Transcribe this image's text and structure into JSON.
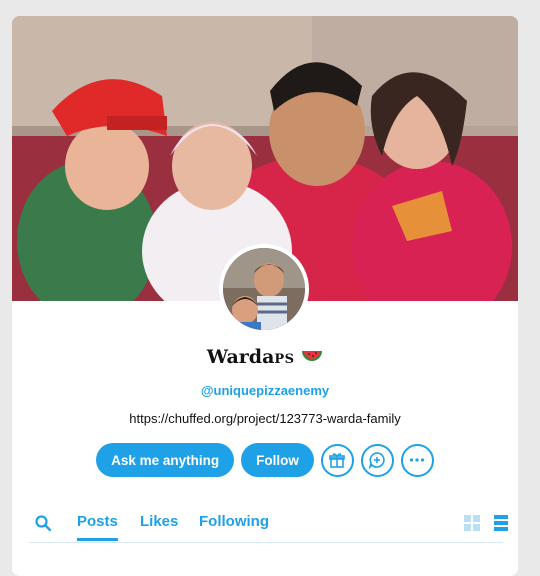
{
  "profile": {
    "name": "Warda",
    "name_suffix": "PS",
    "handle": "@uniquepizzaenemy",
    "url": "https://chuffed.org/project/123773-warda-family"
  },
  "actions": {
    "ask_label": "Ask me anything",
    "follow_label": "Follow",
    "icons": [
      "gift-icon",
      "message-plus-icon",
      "more-icon"
    ]
  },
  "tabs": {
    "items": [
      "Posts",
      "Likes",
      "Following"
    ],
    "active": "Posts"
  },
  "colors": {
    "accent": "#1ea1e6",
    "background": "#e9e9e9"
  }
}
